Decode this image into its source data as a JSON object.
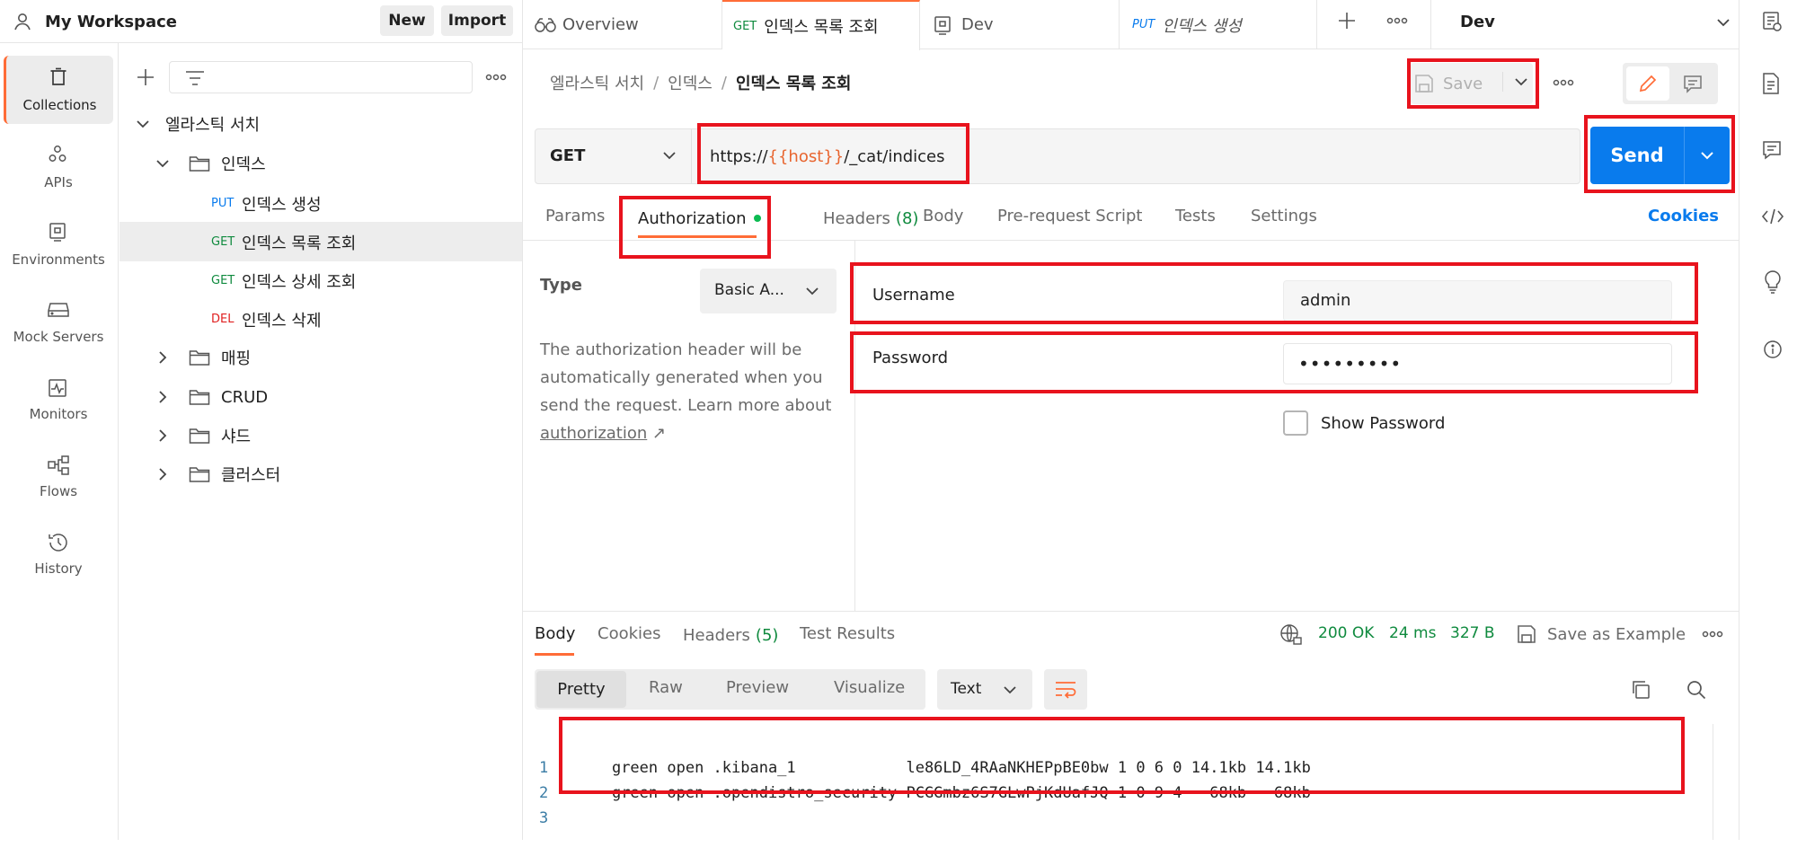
{
  "workspace": {
    "name": "My Workspace",
    "new_label": "New",
    "import_label": "Import"
  },
  "nav": [
    {
      "label": "Collections",
      "icon": "trash-can-icon"
    },
    {
      "label": "APIs",
      "icon": "apis-icon"
    },
    {
      "label": "Environments",
      "icon": "environments-icon"
    },
    {
      "label": "Mock Servers",
      "icon": "server-icon"
    },
    {
      "label": "Monitors",
      "icon": "monitor-icon"
    },
    {
      "label": "Flows",
      "icon": "flows-icon"
    },
    {
      "label": "History",
      "icon": "history-icon"
    }
  ],
  "tree": {
    "root": "엘라스틱 서치",
    "folder_open": "인덱스",
    "requests": [
      {
        "method": "PUT",
        "name": "인덱스 생성"
      },
      {
        "method": "GET",
        "name": "인덱스 목록 조회"
      },
      {
        "method": "GET",
        "name": "인덱스 상세 조회"
      },
      {
        "method": "DEL",
        "name": "인덱스 삭제"
      }
    ],
    "folders": [
      "매핑",
      "CRUD",
      "샤드",
      "클러스터"
    ]
  },
  "tabs": [
    {
      "label": "Overview",
      "method": ""
    },
    {
      "label": "인덱스 목록 조회",
      "method": "GET"
    },
    {
      "label": "Dev",
      "method": ""
    },
    {
      "label": "인덱스 생성",
      "method": "PUT"
    }
  ],
  "environment": "Dev",
  "breadcrumb": {
    "part1": "엘라스틱 서치",
    "sep": "/",
    "part2": "인덱스",
    "current": "인덱스 목록 조회"
  },
  "save_label": "Save",
  "request": {
    "method": "GET",
    "url_prefix": "https://",
    "url_var": "{{host}}",
    "url_suffix": "/_cat/indices",
    "send_label": "Send"
  },
  "req_tabs": {
    "params": "Params",
    "authorization": "Authorization",
    "headers": "Headers",
    "headers_count": "(8)",
    "body": "Body",
    "prerequest": "Pre-request Script",
    "tests": "Tests",
    "settings": "Settings",
    "cookies": "Cookies"
  },
  "auth": {
    "type_label": "Type",
    "type_value": "Basic A...",
    "description": "The authorization header will be automatically generated when you send the request. Learn more about",
    "link": "authorization",
    "link_arrow": "↗",
    "username_label": "Username",
    "username_value": "admin",
    "password_label": "Password",
    "password_value": "•••••••••",
    "show_password": "Show Password"
  },
  "response": {
    "body": "Body",
    "cookies": "Cookies",
    "headers": "Headers",
    "headers_count": "(5)",
    "test_results": "Test Results",
    "status": "200 OK",
    "time": "24 ms",
    "size": "327 B",
    "save_example": "Save as Example",
    "view_tabs": [
      "Pretty",
      "Raw",
      "Preview",
      "Visualize"
    ],
    "format": "Text",
    "lines": [
      {
        "n": "1",
        "text": "green open .kibana_1            le86LD_4RAaNKHEPpBE0bw 1 0 6 0 14.1kb 14.1kb"
      },
      {
        "n": "2",
        "text": "green open .opendistro_security PCGGmbz6S7GLwPjKdUafJQ 1 0 9 4   68kb   68kb"
      },
      {
        "n": "3",
        "text": ""
      }
    ]
  }
}
